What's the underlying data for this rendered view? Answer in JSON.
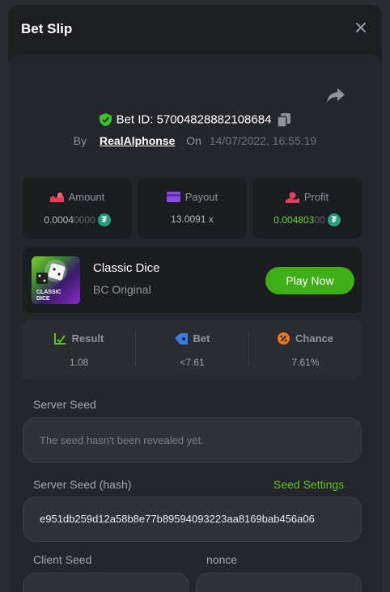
{
  "header": {
    "title": "Bet Slip"
  },
  "bet": {
    "id_label": "Bet ID: 57004828882108684",
    "by_label": "By",
    "user": "RealAlphonse",
    "on_label": "On",
    "date": "14/07/2022, 16:55:19"
  },
  "stats": {
    "amount": {
      "label": "Amount",
      "value_main": "0.0004",
      "value_dim": "0000"
    },
    "payout": {
      "label": "Payout",
      "value": "13.0091 x"
    },
    "profit": {
      "label": "Profit",
      "value_main": "0.004803",
      "value_dim": "00"
    },
    "currency_symbol": "₮"
  },
  "game": {
    "name": "Classic Dice",
    "subtitle": "BC Original",
    "thumb_text_1": "CLASSIC",
    "thumb_text_2": "DICE",
    "play_label": "Play Now"
  },
  "result_panel": {
    "result": {
      "label": "Result",
      "value": "1.08"
    },
    "bet": {
      "label": "Bet",
      "value": "<7.61"
    },
    "chance": {
      "label": "Chance",
      "value": "7.61%"
    }
  },
  "seeds": {
    "server_seed_label": "Server Seed",
    "server_seed_placeholder": "The seed hasn't been revealed yet.",
    "server_hash_label": "Server Seed (hash)",
    "seed_settings_label": "Seed Settings",
    "server_hash_value": "e951db259d12a58b8e77b89594093223aa8169bab456a06",
    "client_seed_label": "Client Seed",
    "nonce_label": "nonce"
  },
  "colors": {
    "accent_green": "#3fae18",
    "profit_green": "#6bd437",
    "tether": "#26a17b"
  }
}
